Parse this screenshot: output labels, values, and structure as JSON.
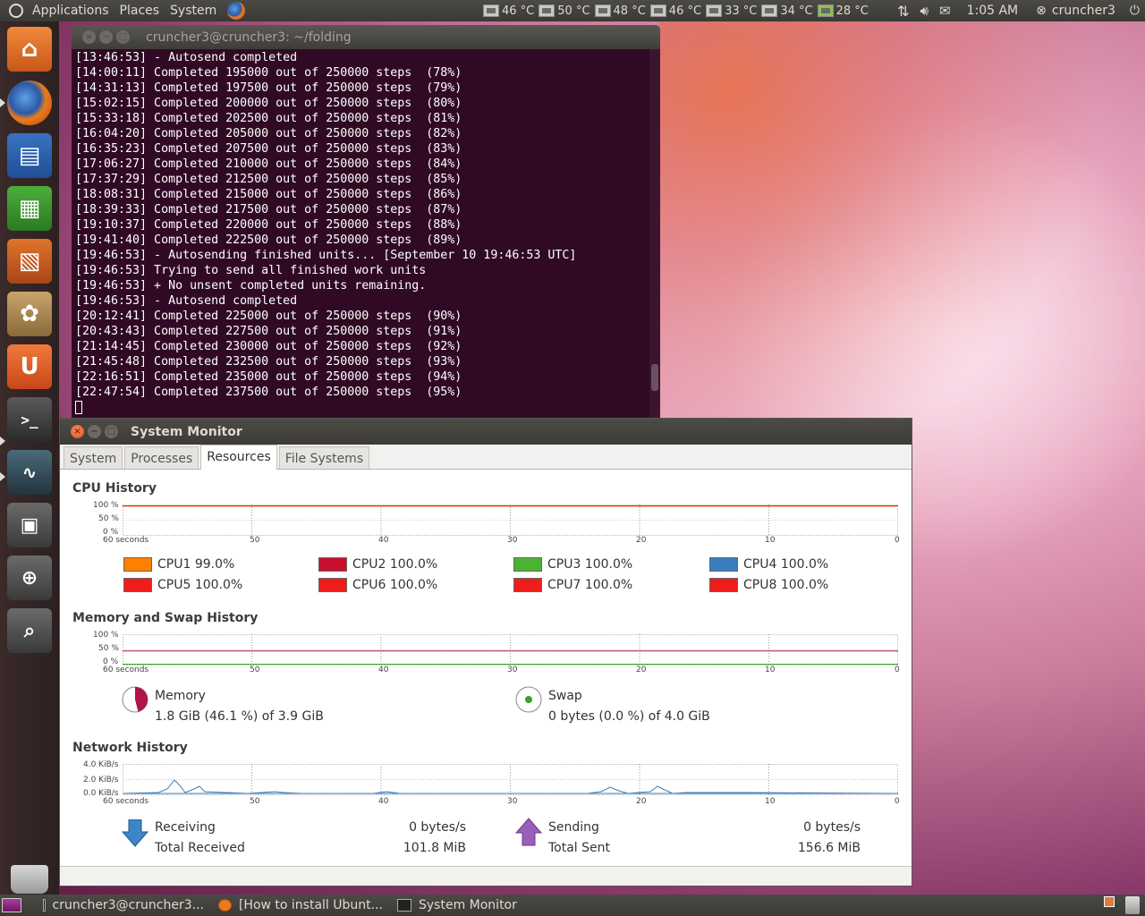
{
  "top_panel": {
    "menus": [
      "Applications",
      "Places",
      "System"
    ],
    "sensors": [
      "46 °C",
      "50 °C",
      "48 °C",
      "46 °C",
      "33 °C",
      "34 °C",
      "28 °C"
    ],
    "clock": "1:05 AM",
    "user": "cruncher3"
  },
  "terminal": {
    "title": "cruncher3@cruncher3: ~/folding",
    "lines": [
      "[13:46:53] - Autosend completed",
      "[14:00:11] Completed 195000 out of 250000 steps  (78%)",
      "[14:31:13] Completed 197500 out of 250000 steps  (79%)",
      "[15:02:15] Completed 200000 out of 250000 steps  (80%)",
      "[15:33:18] Completed 202500 out of 250000 steps  (81%)",
      "[16:04:20] Completed 205000 out of 250000 steps  (82%)",
      "[16:35:23] Completed 207500 out of 250000 steps  (83%)",
      "[17:06:27] Completed 210000 out of 250000 steps  (84%)",
      "[17:37:29] Completed 212500 out of 250000 steps  (85%)",
      "[18:08:31] Completed 215000 out of 250000 steps  (86%)",
      "[18:39:33] Completed 217500 out of 250000 steps  (87%)",
      "[19:10:37] Completed 220000 out of 250000 steps  (88%)",
      "[19:41:40] Completed 222500 out of 250000 steps  (89%)",
      "[19:46:53] - Autosending finished units... [September 10 19:46:53 UTC]",
      "[19:46:53] Trying to send all finished work units",
      "[19:46:53] + No unsent completed units remaining.",
      "[19:46:53] - Autosend completed",
      "[20:12:41] Completed 225000 out of 250000 steps  (90%)",
      "[20:43:43] Completed 227500 out of 250000 steps  (91%)",
      "[21:14:45] Completed 230000 out of 250000 steps  (92%)",
      "[21:45:48] Completed 232500 out of 250000 steps  (93%)",
      "[22:16:51] Completed 235000 out of 250000 steps  (94%)",
      "[22:47:54] Completed 237500 out of 250000 steps  (95%)"
    ]
  },
  "sysmon": {
    "title": "System Monitor",
    "tabs": [
      "System",
      "Processes",
      "Resources",
      "File Systems"
    ],
    "active_tab": "Resources",
    "cpu_title": "CPU History",
    "mem_title": "Memory and Swap History",
    "net_title": "Network History",
    "pct_ticks": [
      "100 %",
      "50 %",
      "0 %"
    ],
    "net_ticks": [
      "4.0 KiB/s",
      "2.0 KiB/s",
      "0.0 KiB/s"
    ],
    "x_ticks": [
      "60 seconds",
      "50",
      "40",
      "30",
      "20",
      "10",
      "0"
    ],
    "cpus": [
      {
        "label": "CPU1",
        "value": "99.0%",
        "color": "#ff7f00"
      },
      {
        "label": "CPU2",
        "value": "100.0%",
        "color": "#c8102e"
      },
      {
        "label": "CPU3",
        "value": "100.0%",
        "color": "#4cb332"
      },
      {
        "label": "CPU4",
        "value": "100.0%",
        "color": "#3a7ebf"
      },
      {
        "label": "CPU5",
        "value": "100.0%",
        "color": "#ef1c1c"
      },
      {
        "label": "CPU6",
        "value": "100.0%",
        "color": "#ef1c1c"
      },
      {
        "label": "CPU7",
        "value": "100.0%",
        "color": "#ef1c1c"
      },
      {
        "label": "CPU8",
        "value": "100.0%",
        "color": "#ef1c1c"
      }
    ],
    "memory": {
      "label": "Memory",
      "value": "1.8 GiB (46.1 %) of 3.9 GiB",
      "fraction": 0.461,
      "color": "#b0144a"
    },
    "swap": {
      "label": "Swap",
      "value": "0 bytes (0.0 %) of 4.0 GiB",
      "fraction": 0.0,
      "color": "#3aa02a"
    },
    "network": {
      "receiving_label": "Receiving",
      "receiving_value": "0 bytes/s",
      "total_received_label": "Total Received",
      "total_received_value": "101.8 MiB",
      "sending_label": "Sending",
      "sending_value": "0 bytes/s",
      "total_sent_label": "Total Sent",
      "total_sent_value": "156.6 MiB"
    }
  },
  "bottom_panel": {
    "tasks": [
      "cruncher3@cruncher3...",
      "[How to install Ubunt...",
      "System Monitor"
    ]
  }
}
